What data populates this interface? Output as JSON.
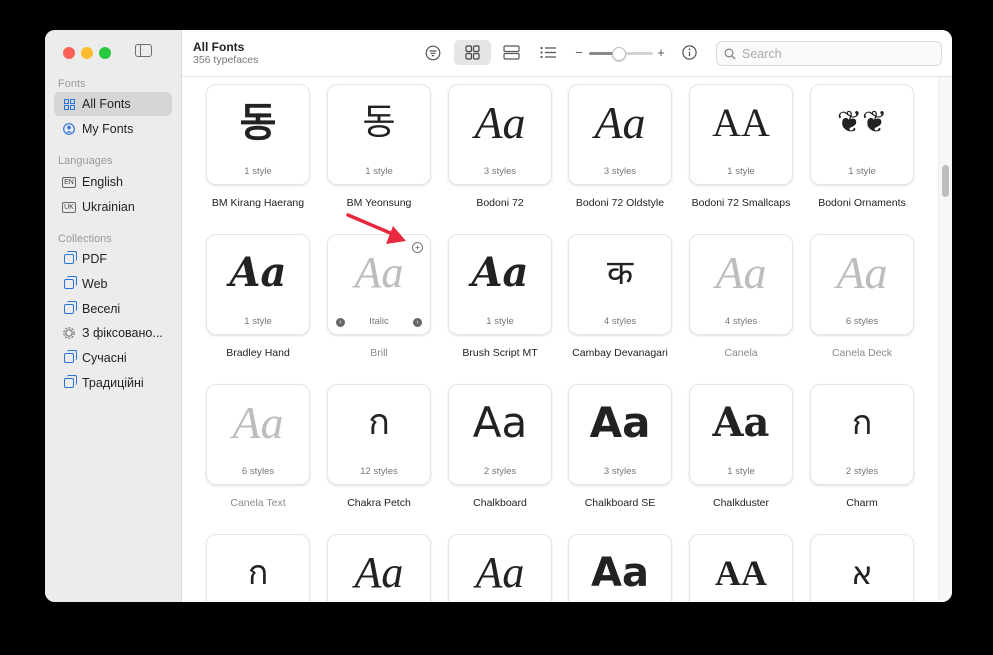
{
  "sidebar": {
    "fonts_title": "Fonts",
    "languages_title": "Languages",
    "collections_title": "Collections",
    "items": {
      "all_fonts": "All Fonts",
      "my_fonts": "My Fonts",
      "english": "English",
      "english_badge": "EN",
      "ukrainian": "Ukrainian",
      "ukrainian_badge": "UK",
      "pdf": "PDF",
      "web": "Web",
      "veseli": "Веселі",
      "fixed": "З фіксовано...",
      "suchasni": "Сучасні",
      "tradytsiini": "Традиційні"
    }
  },
  "header": {
    "title": "All Fonts",
    "subtitle": "356 typefaces"
  },
  "search": {
    "placeholder": "Search",
    "value": ""
  },
  "zoom": {
    "minus": "−",
    "plus": "+",
    "level": 0.45
  },
  "fonts": [
    {
      "name": "BM Kirang Haerang",
      "styles": "1 style",
      "sample": "동"
    },
    {
      "name": "BM Yeonsung",
      "styles": "1 style",
      "sample": "동"
    },
    {
      "name": "Bodoni 72",
      "styles": "3 styles",
      "sample": "Aa"
    },
    {
      "name": "Bodoni 72 Oldstyle",
      "styles": "3 styles",
      "sample": "Aa"
    },
    {
      "name": "Bodoni 72 Smallcaps",
      "styles": "1 style",
      "sample": "AA"
    },
    {
      "name": "Bodoni Ornaments",
      "styles": "1 style",
      "sample": "❦❦"
    },
    {
      "name": "Bradley Hand",
      "styles": "1 style",
      "sample": "Aa"
    },
    {
      "name": "Brill",
      "styles": "Italic",
      "sample": "Aa"
    },
    {
      "name": "Brush Script MT",
      "styles": "1 style",
      "sample": "Aa"
    },
    {
      "name": "Cambay Devanagari",
      "styles": "4 styles",
      "sample": "क"
    },
    {
      "name": "Canela",
      "styles": "4 styles",
      "sample": "Aa"
    },
    {
      "name": "Canela Deck",
      "styles": "6 styles",
      "sample": "Aa"
    },
    {
      "name": "Canela Text",
      "styles": "6 styles",
      "sample": "Aa"
    },
    {
      "name": "Chakra Petch",
      "styles": "12 styles",
      "sample": "ก"
    },
    {
      "name": "Chalkboard",
      "styles": "2 styles",
      "sample": "Aa"
    },
    {
      "name": "Chalkboard SE",
      "styles": "3 styles",
      "sample": "Aa"
    },
    {
      "name": "Chalkduster",
      "styles": "1 style",
      "sample": "Aa"
    },
    {
      "name": "Charm",
      "styles": "2 styles",
      "sample": "ก"
    },
    {
      "name": "",
      "styles": "",
      "sample": "ก"
    },
    {
      "name": "",
      "styles": "",
      "sample": "Aa"
    },
    {
      "name": "",
      "styles": "",
      "sample": "Aa"
    },
    {
      "name": "",
      "styles": "",
      "sample": "Aa"
    },
    {
      "name": "",
      "styles": "",
      "sample": "AA"
    },
    {
      "name": "",
      "styles": "",
      "sample": "א"
    }
  ],
  "colors": {
    "accent": "#2a74da",
    "arrow": "#e8283c"
  }
}
